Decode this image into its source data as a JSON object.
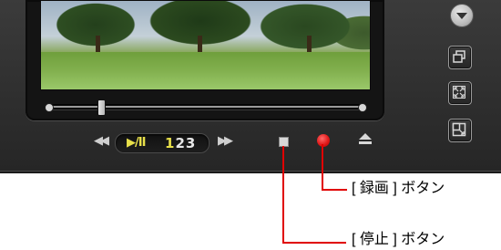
{
  "player": {
    "controls": {
      "rewind_icon": "rewind-icon",
      "play_pause_glyph": "▶/II",
      "speed_prefix": "1",
      "speed_rest": "23",
      "fast_forward_icon": "fast-forward-icon",
      "stop_icon": "stop-icon",
      "record_icon": "record-icon",
      "eject_icon": "eject-icon"
    },
    "side_buttons": [
      "menu-down-icon",
      "window-icon",
      "fullscreen-icon",
      "resize-icon"
    ],
    "colors": {
      "record": "#e11a1a",
      "highlight": "#e8e04a",
      "callout_line": "#e00000"
    }
  },
  "annotations": {
    "record_label": "[ 録画 ] ボタン",
    "stop_label": "[ 停止 ] ボタン"
  }
}
